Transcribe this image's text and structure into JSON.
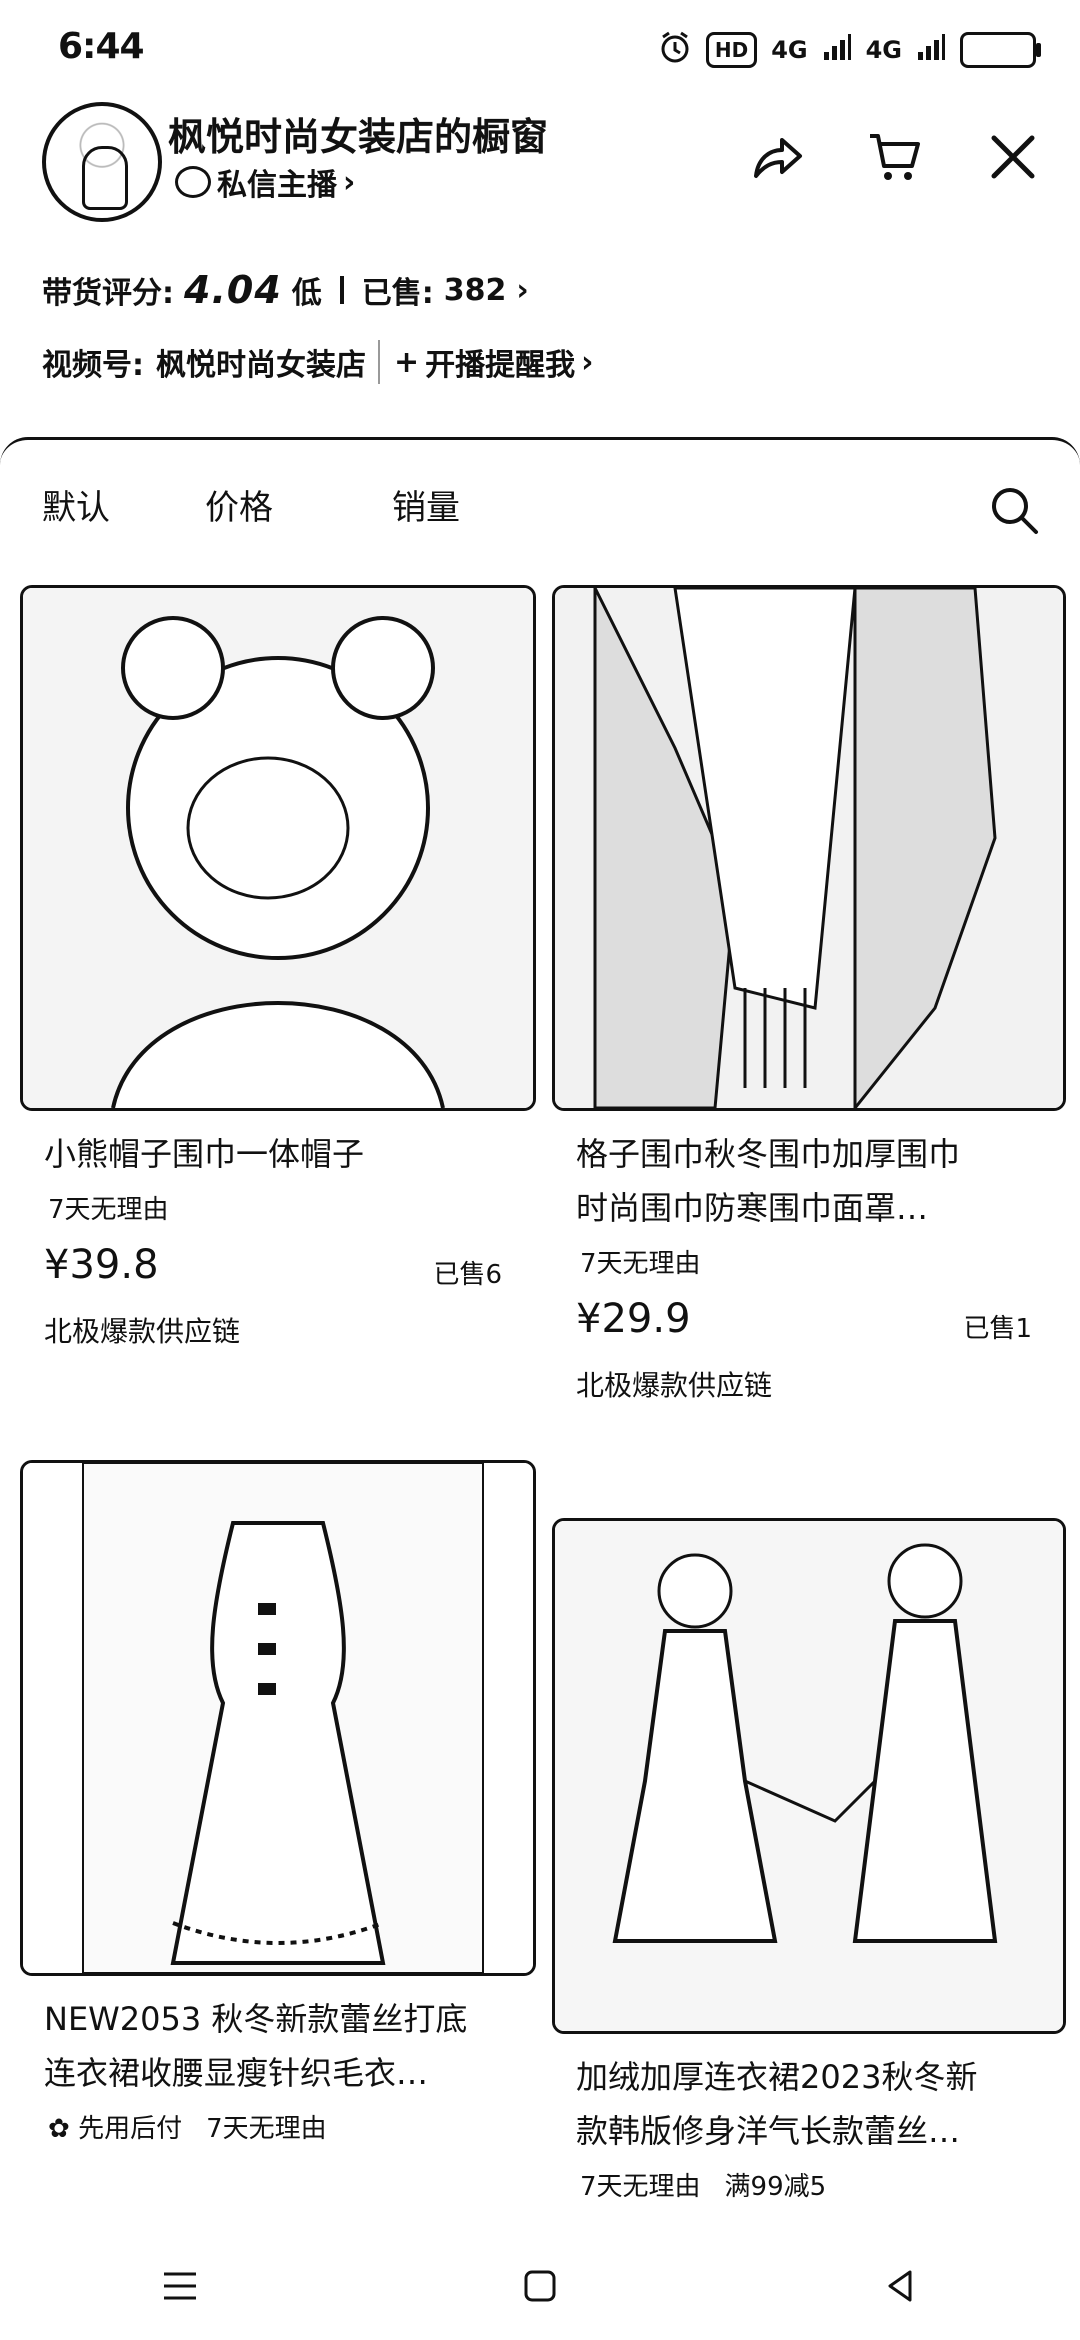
{
  "status_bar": {
    "time": "6:44",
    "hd_label": "HD",
    "signal1": "4G",
    "signal2": "4G"
  },
  "shop": {
    "name": "枫悦时尚女装店的橱窗",
    "dm_label": "私信主播",
    "rating_label": "带货评分:",
    "rating_value": "4.04",
    "rating_level": "低",
    "sold_label": "已售:",
    "sold_value": "382",
    "channel_label": "视频号:",
    "channel_name": "枫悦时尚女装店",
    "remind_label": "开播提醒我"
  },
  "sort_tabs": [
    "默认",
    "价格",
    "销量"
  ],
  "products": [
    {
      "title_line1": "小熊帽子围巾一体帽子",
      "title_line2": "",
      "tags": [
        "7天无理由"
      ],
      "price": "¥39.8",
      "sold": "已售6",
      "supplier": "北极爆款供应链"
    },
    {
      "title_line1": "格子围巾秋冬围巾加厚围巾",
      "title_line2": "时尚围巾防寒围巾面罩…",
      "tags": [
        "7天无理由"
      ],
      "price": "¥29.9",
      "sold": "已售1",
      "supplier": "北极爆款供应链"
    },
    {
      "title_line1": "NEW2053 秋冬新款蕾丝打底",
      "title_line2": "连衣裙收腰显瘦针织毛衣…",
      "tags": [
        "先用后付",
        "7天无理由"
      ],
      "price": "",
      "sold": "",
      "supplier": ""
    },
    {
      "title_line1": "加绒加厚连衣裙2023秋冬新",
      "title_line2": "款韩版修身洋气长款蕾丝…",
      "tags": [
        "7天无理由",
        "满99减5"
      ],
      "price": "",
      "sold": "",
      "supplier": ""
    }
  ],
  "colors": {
    "text": "#111111",
    "background": "#ffffff"
  }
}
